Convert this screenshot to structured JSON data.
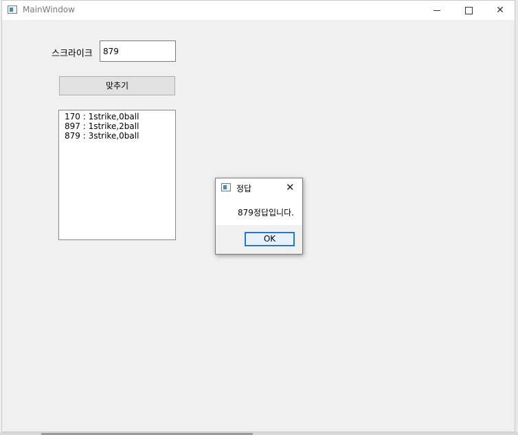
{
  "window": {
    "title": "MainWindow"
  },
  "form": {
    "label": "스크라이크",
    "input_value": "879",
    "guess_button": "맞추기"
  },
  "history": [
    "170 : 1strike,0ball",
    "897 : 1strike,2ball",
    "879 : 3strike,0ball"
  ],
  "dialog": {
    "title": "정답",
    "message": "879정답입니다.",
    "ok_label": "OK"
  },
  "colors": {
    "accent": "#2a74c6"
  },
  "icons": [
    "app-icon",
    "minimize-icon",
    "maximize-icon",
    "close-icon"
  ]
}
